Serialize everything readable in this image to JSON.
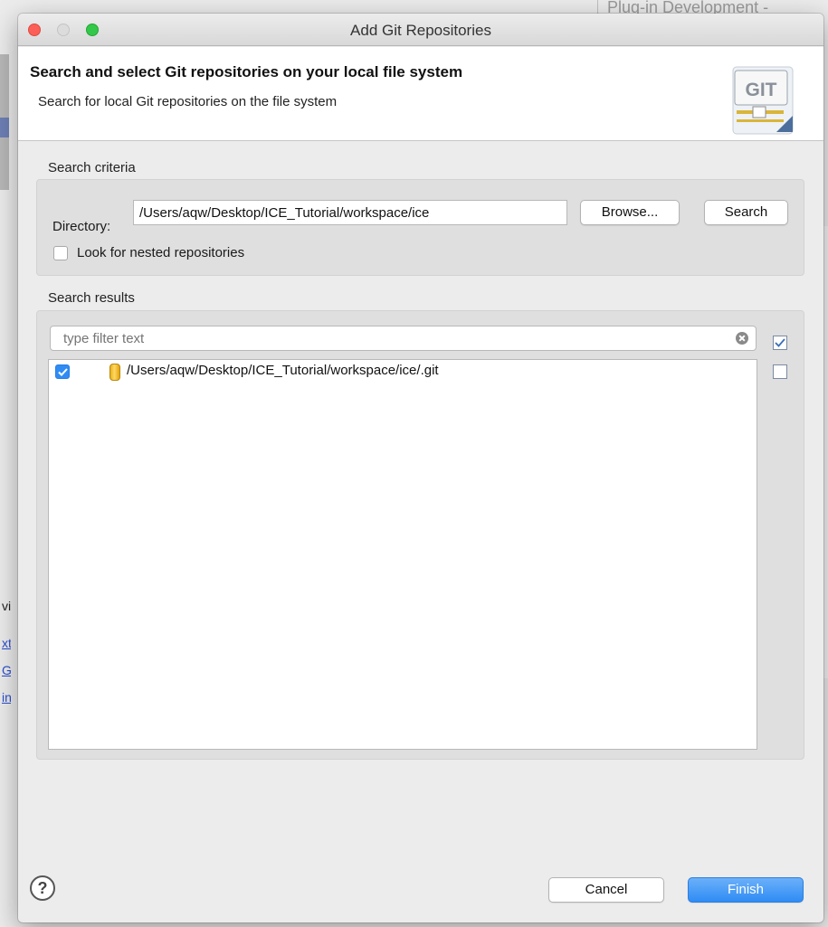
{
  "background_window": {
    "title_fragment": "Plug-in Development - ",
    "links": [
      "xt",
      "Gi",
      "in"
    ],
    "text_fragment": "vi"
  },
  "dialog": {
    "title": "Add Git Repositories",
    "banner": {
      "heading": "Search and select Git repositories on your local file system",
      "description": "Search for local Git repositories on the file system",
      "logo_text": "GIT"
    },
    "search_criteria": {
      "label": "Search criteria",
      "directory_label": "Directory:",
      "directory_value": "/Users/aqw/Desktop/ICE_Tutorial/workspace/ice",
      "browse_label": "Browse...",
      "search_label": "Search",
      "nested_label": "Look for nested repositories",
      "nested_checked": false
    },
    "search_results": {
      "label": "Search results",
      "filter_placeholder": "type filter text",
      "results": [
        {
          "path": "/Users/aqw/Desktop/ICE_Tutorial/workspace/ice/.git",
          "checked": true
        }
      ]
    },
    "footer": {
      "help_symbol": "?",
      "cancel_label": "Cancel",
      "finish_label": "Finish"
    }
  },
  "colors": {
    "accent": "#2f8cf4",
    "close": "#fc5f57",
    "maximize": "#34c84a",
    "repo_icon": "#f2c230"
  },
  "icons": [
    "close-window-icon",
    "minimize-window-icon",
    "zoom-window-icon",
    "git-logo-icon",
    "clear-filter-icon",
    "select-all-icon",
    "deselect-all-icon",
    "git-repository-icon",
    "help-icon",
    "checkmark-icon"
  ]
}
